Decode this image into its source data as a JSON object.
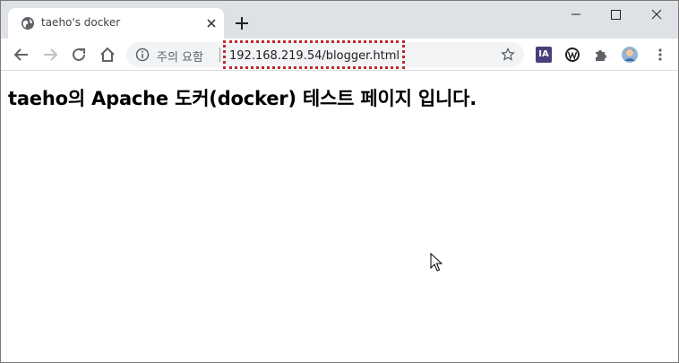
{
  "colors": {
    "tab_strip_bg": "#dee1e6",
    "omnibox_bg": "#f1f3f4",
    "url_highlight": "#c0282d",
    "ext_ia_bg": "#4a3f7a"
  },
  "tab": {
    "title": "taeho's docker",
    "icon": "globe-icon",
    "close_icon": "close-icon"
  },
  "new_tab": {
    "icon": "plus-icon"
  },
  "window_controls": {
    "minimize": "minimize-icon",
    "maximize": "maximize-icon",
    "close": "close-icon"
  },
  "toolbar": {
    "back_icon": "arrow-left-icon",
    "forward_icon": "arrow-right-icon",
    "reload_icon": "reload-icon",
    "home_icon": "home-icon"
  },
  "omnibox": {
    "security_icon": "info-icon",
    "security_label": "주의 요함",
    "url": "192.168.219.54/blogger.html",
    "bookmark_icon": "star-icon"
  },
  "extensions": {
    "ia_label": "IA",
    "w_icon": "wordpress-icon",
    "puzzle_icon": "puzzle-icon",
    "avatar_icon": "profile-avatar-icon",
    "menu_icon": "kebab-menu-icon"
  },
  "page": {
    "heading": "taeho의 Apache 도커(docker) 테스트 페이지 입니다."
  }
}
